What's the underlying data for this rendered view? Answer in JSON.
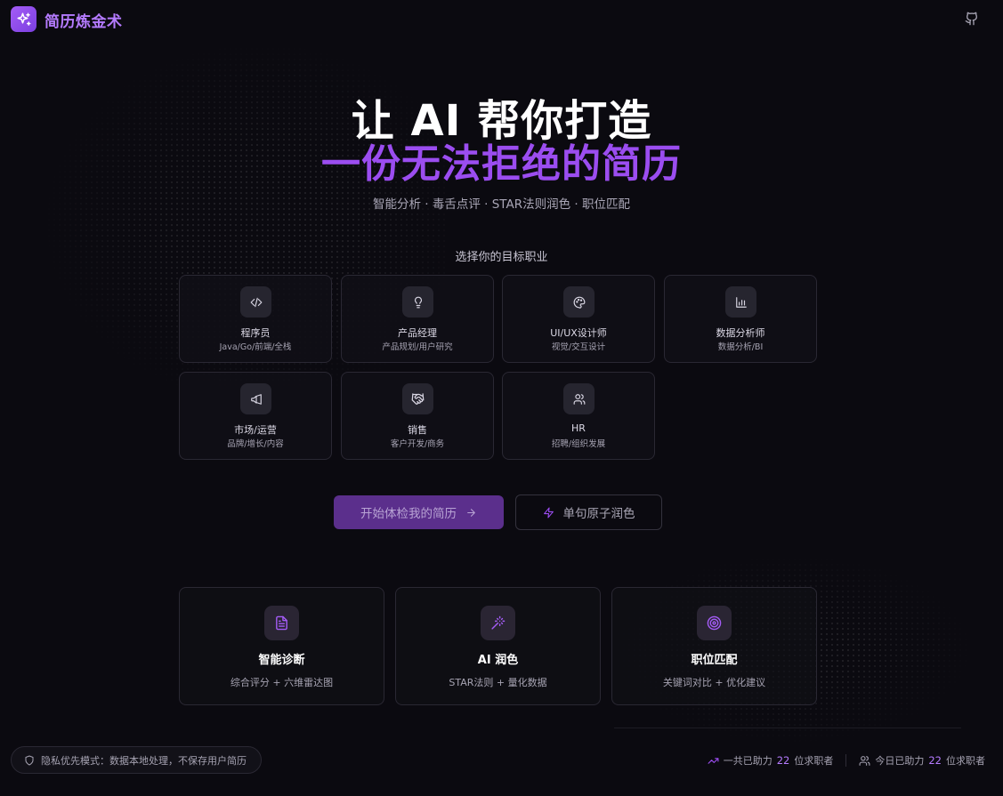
{
  "header": {
    "brand": "简历炼金术",
    "logo_icon": "sparkles-icon",
    "github_icon": "github-icon"
  },
  "hero": {
    "line1": "让 AI 帮你打造",
    "line2": "一份无法拒绝的简历",
    "subtitle": "智能分析 · 毒舌点评 · STAR法则润色 · 职位匹配"
  },
  "roles_label": "选择你的目标职业",
  "roles": [
    {
      "title": "程序员",
      "desc": "Java/Go/前端/全栈",
      "icon": "code-icon"
    },
    {
      "title": "产品经理",
      "desc": "产品规划/用户研究",
      "icon": "lightbulb-icon"
    },
    {
      "title": "UI/UX设计师",
      "desc": "视觉/交互设计",
      "icon": "palette-icon"
    },
    {
      "title": "数据分析师",
      "desc": "数据分析/BI",
      "icon": "bar-chart-icon"
    },
    {
      "title": "市场/运营",
      "desc": "品牌/增长/内容",
      "icon": "megaphone-icon"
    },
    {
      "title": "销售",
      "desc": "客户开发/商务",
      "icon": "handshake-icon"
    },
    {
      "title": "HR",
      "desc": "招聘/组织发展",
      "icon": "users-icon"
    }
  ],
  "actions": {
    "primary": "开始体检我的简历",
    "secondary": "单句原子润色"
  },
  "features": [
    {
      "title": "智能诊断",
      "desc": "综合评分 + 六维雷达图",
      "icon": "file-text-icon"
    },
    {
      "title": "AI 润色",
      "desc": "STAR法则 + 量化数据",
      "icon": "magic-wand-icon"
    },
    {
      "title": "职位匹配",
      "desc": "关键词对比 + 优化建议",
      "icon": "target-icon"
    }
  ],
  "footer": {
    "privacy": "隐私优先模式：数据本地处理，不保存用户简历",
    "total_prefix": "一共已助力",
    "total_count": "22",
    "total_suffix": "位求职者",
    "today_prefix": "今日已助力",
    "today_count": "22",
    "today_suffix": "位求职者"
  },
  "colors": {
    "accent": "#9b4df0",
    "background": "#0b0a10",
    "primary_button": "#5b2f8c"
  }
}
